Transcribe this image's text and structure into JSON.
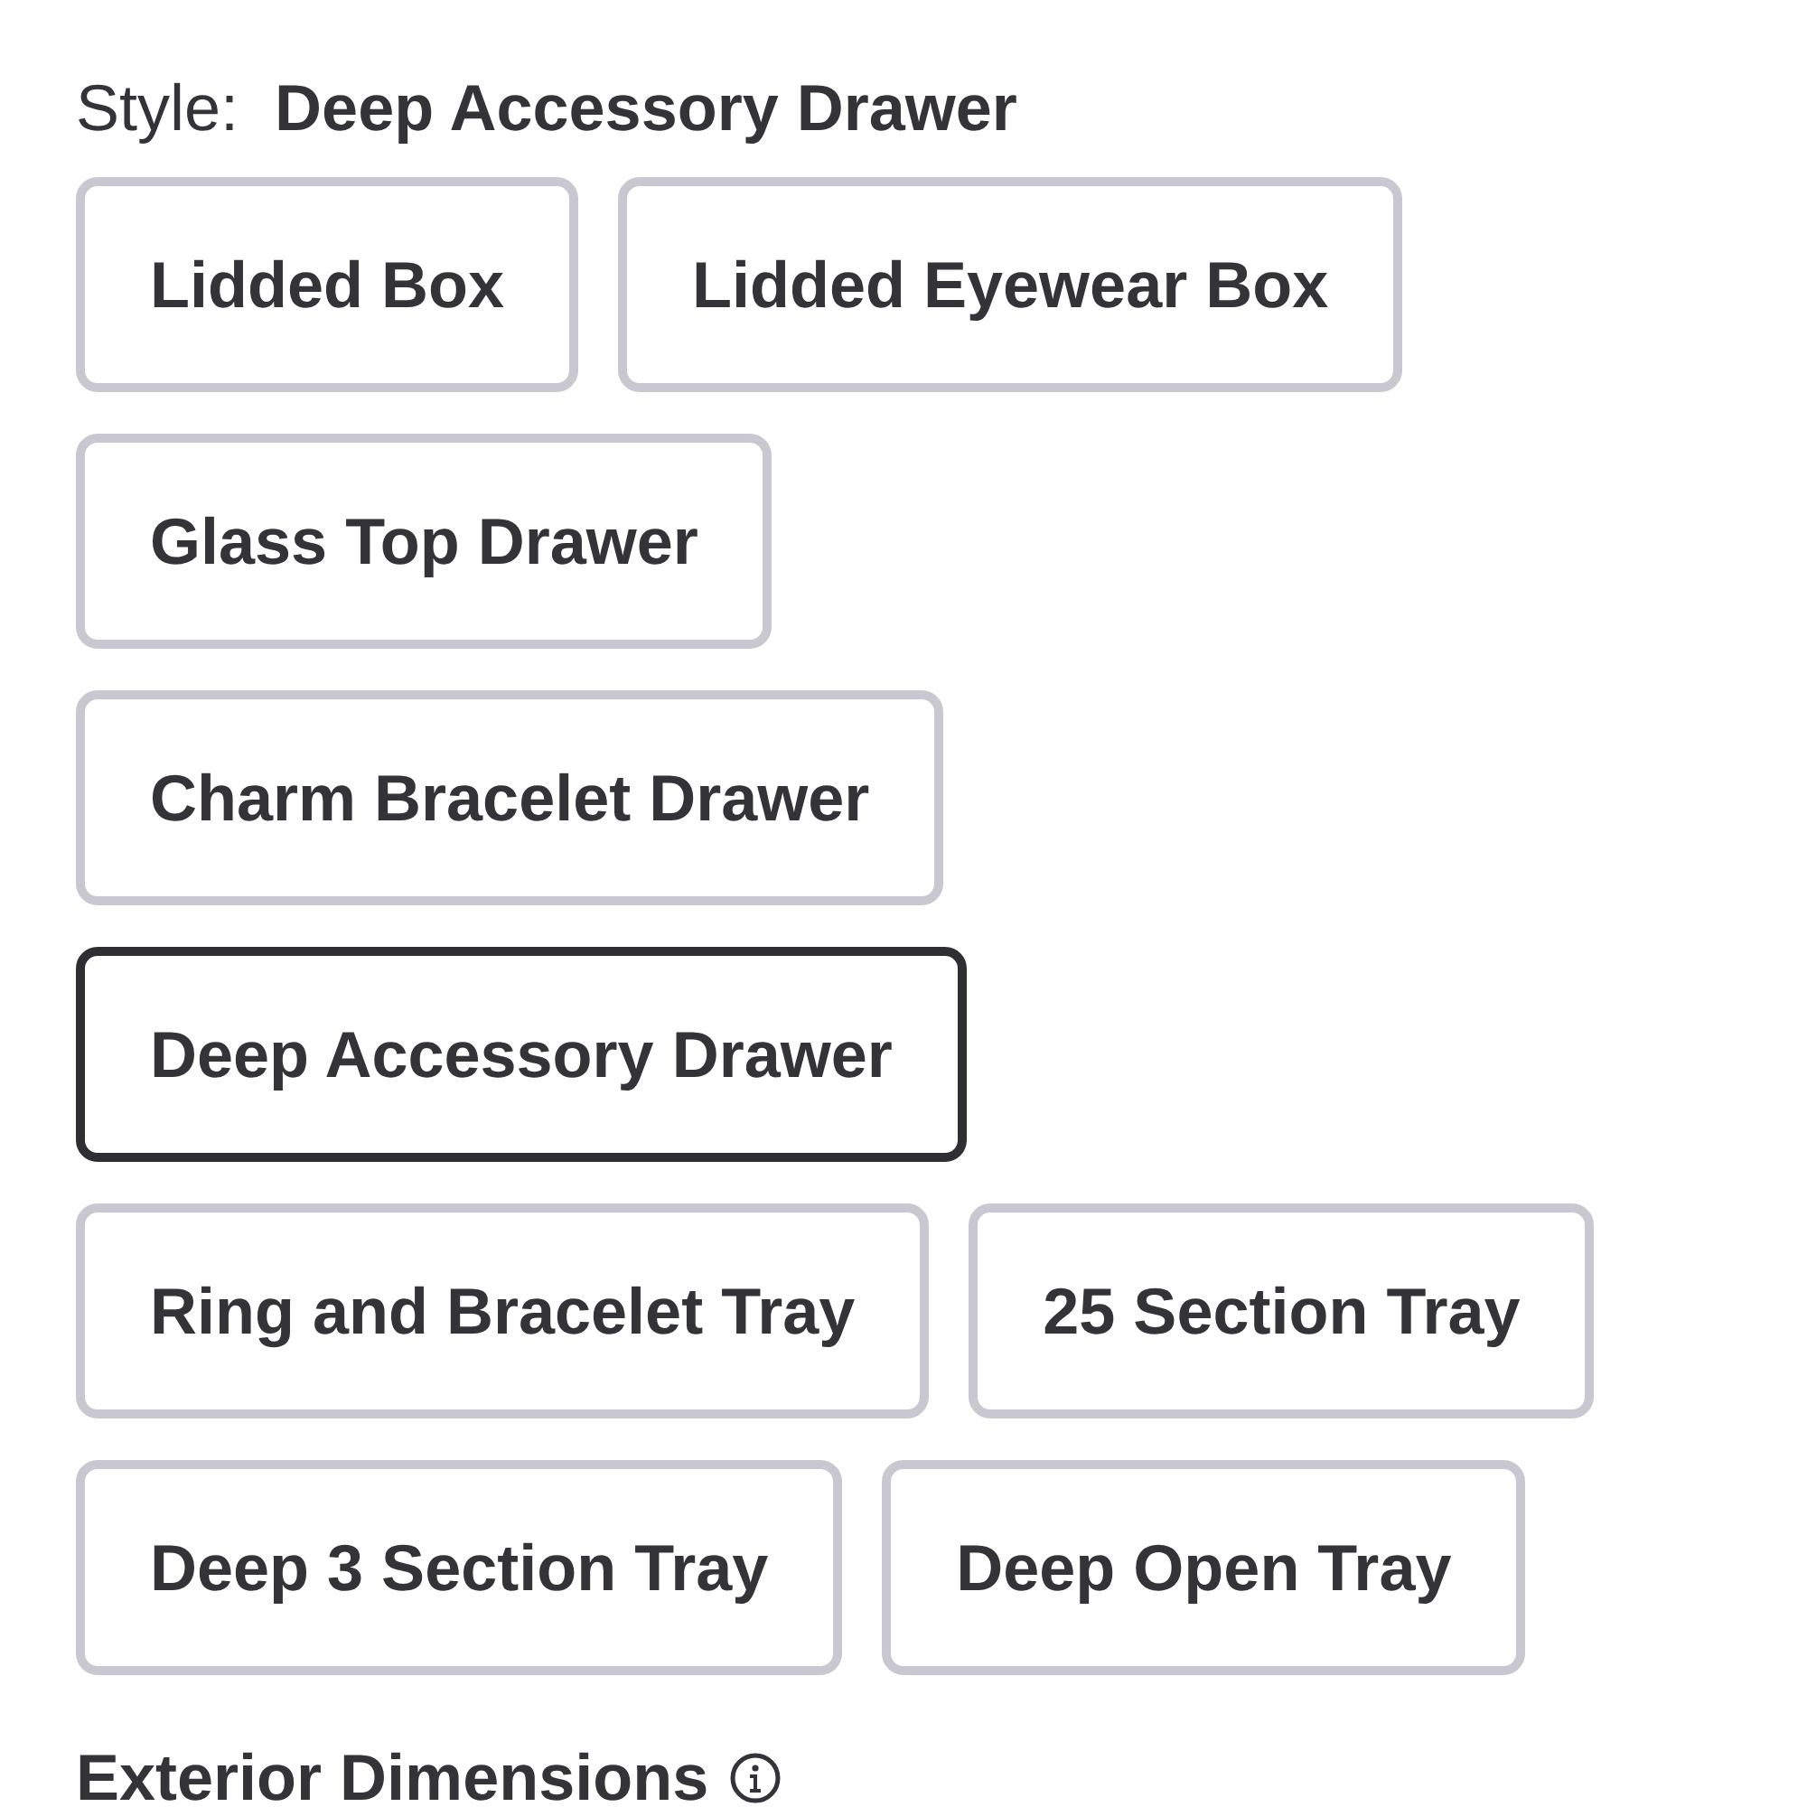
{
  "style_label": {
    "label": "Style:",
    "value": "Deep Accessory Drawer"
  },
  "options": [
    {
      "label": "Lidded Box",
      "selected": false
    },
    {
      "label": "Lidded Eyewear Box",
      "selected": false
    },
    {
      "label": "Glass Top Drawer",
      "selected": false
    },
    {
      "label": "Charm Bracelet Drawer",
      "selected": false
    },
    {
      "label": "Deep Accessory Drawer",
      "selected": true
    },
    {
      "label": "Ring and Bracelet Tray",
      "selected": false
    },
    {
      "label": "25 Section Tray",
      "selected": false
    },
    {
      "label": "Deep 3 Section Tray",
      "selected": false
    },
    {
      "label": "Deep Open Tray",
      "selected": false
    }
  ],
  "section_heading": {
    "label": "Exterior Dimensions"
  }
}
